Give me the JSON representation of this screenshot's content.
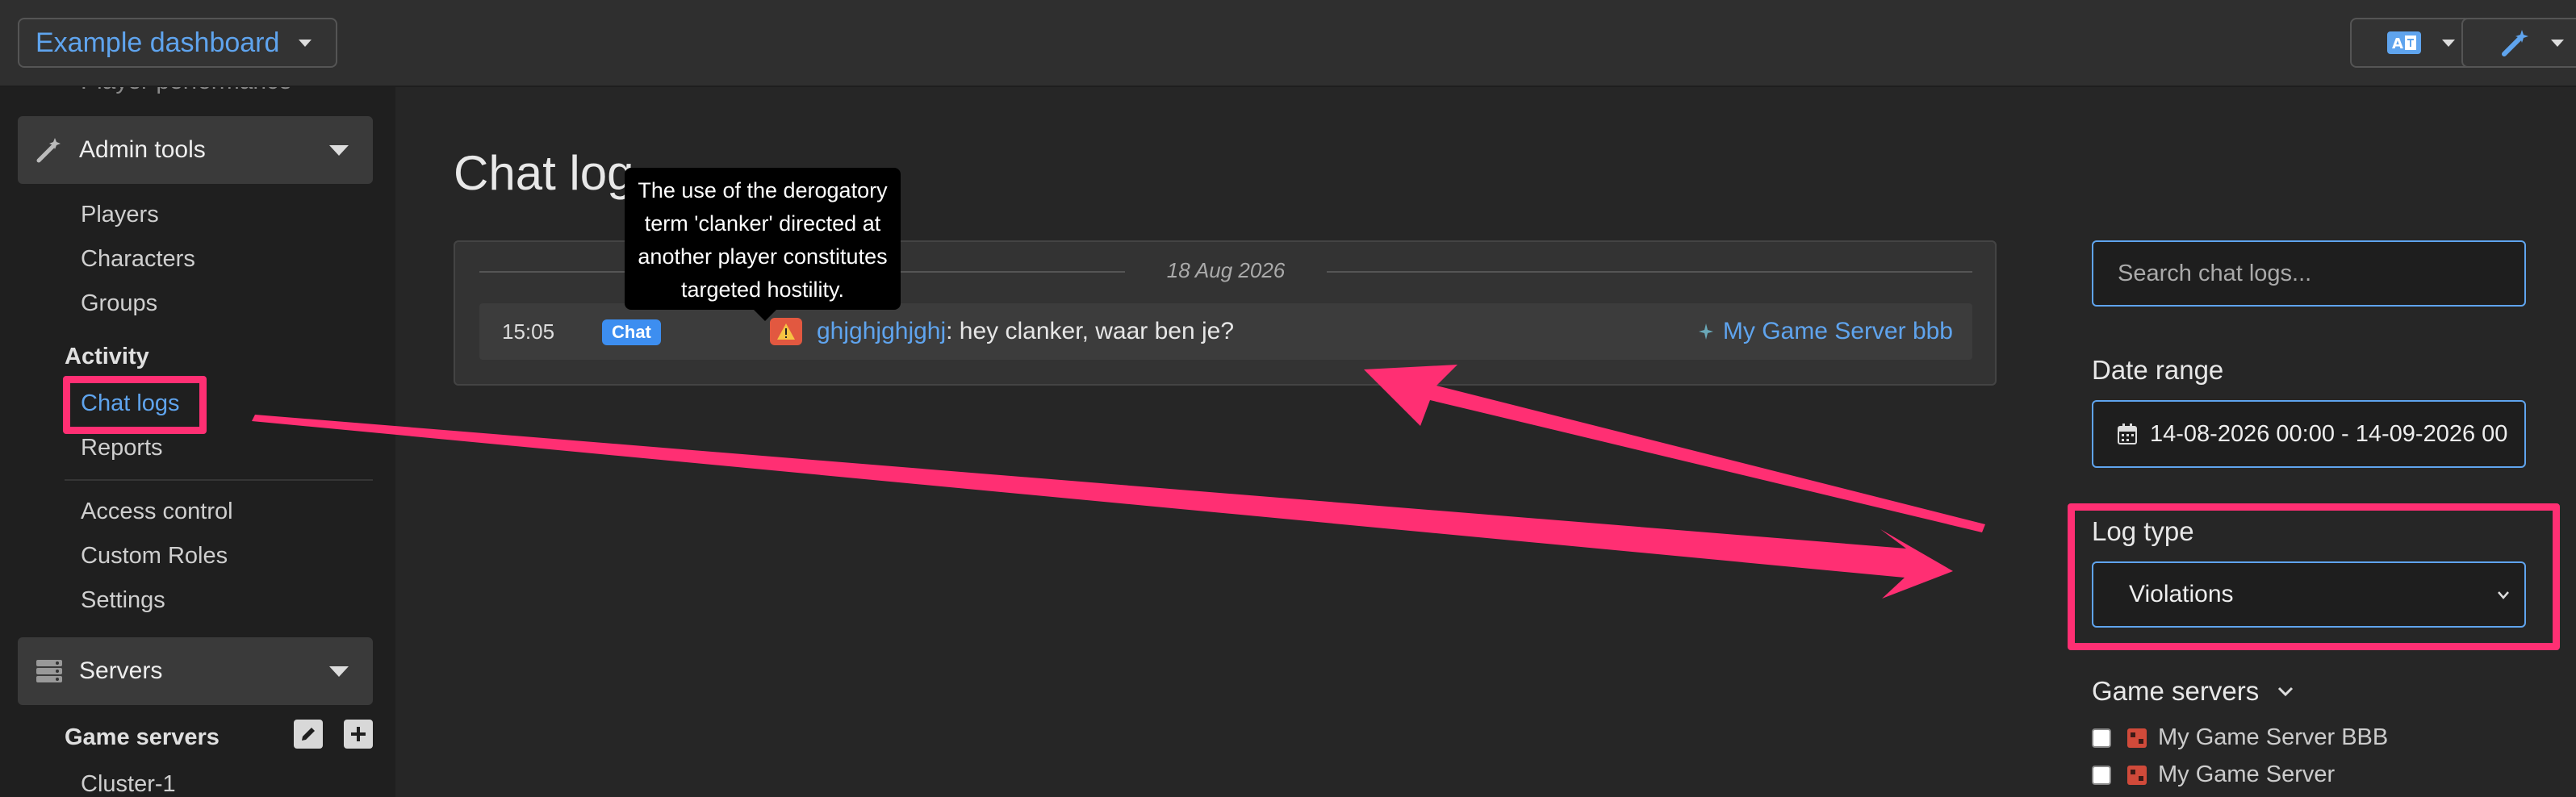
{
  "topbar": {
    "dashboard_select": "Example dashboard",
    "language_icon": "translate-icon",
    "wand_icon": "magic-wand-icon"
  },
  "sidebar": {
    "clipped_item": "Player performance",
    "admin_tools": {
      "label": "Admin tools",
      "icon": "wand-icon"
    },
    "admin_items": [
      "Players",
      "Characters",
      "Groups"
    ],
    "activity_heading": "Activity",
    "activity_items": [
      "Chat logs",
      "Reports"
    ],
    "active_item": "Chat logs",
    "config_items": [
      "Access control",
      "Custom Roles",
      "Settings"
    ],
    "servers": {
      "label": "Servers",
      "icon": "server-icon"
    },
    "game_servers_heading": "Game servers",
    "cluster_item": "Cluster-1"
  },
  "main": {
    "title": "Chat log",
    "date_separator": "18 Aug 2026",
    "log_row": {
      "time": "15:05",
      "type_badge": "Chat",
      "player": "ghjghjghjghj",
      "message": ": hey clanker, waar ben je?",
      "server": "My Game Server bbb"
    },
    "tooltip_lines": [
      "The use of the derogatory",
      "term 'clanker' directed at",
      "another player constitutes",
      "targeted hostility."
    ]
  },
  "filters": {
    "search_placeholder": "Search chat logs...",
    "date_range_label": "Date range",
    "date_range_value": "14-08-2026 00:00 - 14-09-2026 00",
    "log_type_label": "Log type",
    "log_type_value": "Violations",
    "game_servers_label": "Game servers",
    "game_servers": [
      "My Game Server BBB",
      "My Game Server"
    ]
  },
  "colors": {
    "accent": "#5fa4ee",
    "highlight": "#ff2f73",
    "badge": "#3d8ef0",
    "warning": "#e25840"
  }
}
